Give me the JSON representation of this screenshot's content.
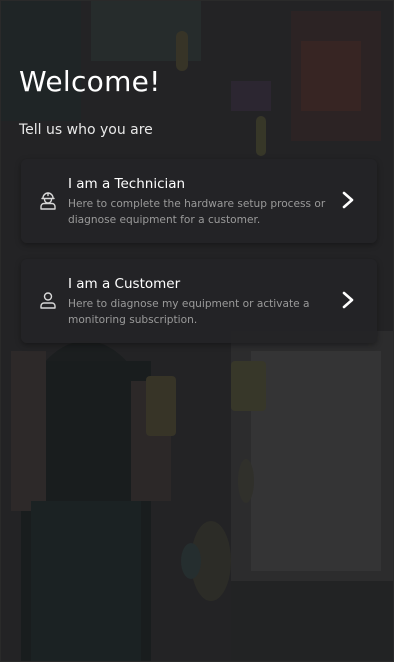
{
  "welcome": {
    "title": "Welcome!",
    "subtitle": "Tell us who you are"
  },
  "options": [
    {
      "title": "I am a Technician",
      "description": "Here to complete the hardware setup process or diagnose equipment for a customer.",
      "icon": "technician-icon"
    },
    {
      "title": "I am a Customer",
      "description": "Here to diagnose my equipment or activate a monitoring subscription.",
      "icon": "customer-icon"
    }
  ],
  "colors": {
    "card_background": "#242426",
    "title_text": "#ffffff",
    "description_text": "#9a9a9a"
  }
}
